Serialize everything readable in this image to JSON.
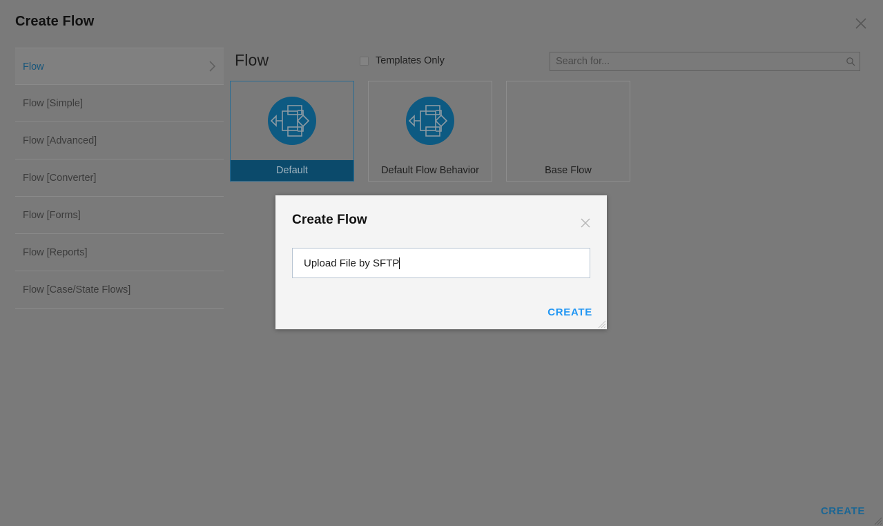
{
  "wizard": {
    "title": "Create Flow",
    "close_icon": "close-icon",
    "create_label": "CREATE",
    "panel_title": "Flow",
    "templates_only_label": "Templates Only",
    "templates_only_checked": false
  },
  "sidebar": {
    "items": [
      {
        "label": "Flow",
        "selected": true,
        "chevron": "chevron-right-icon"
      },
      {
        "label": "Flow [Simple]",
        "selected": false
      },
      {
        "label": "Flow [Advanced]",
        "selected": false
      },
      {
        "label": "Flow [Converter]",
        "selected": false
      },
      {
        "label": "Flow [Forms]",
        "selected": false
      },
      {
        "label": "Flow [Reports]",
        "selected": false
      },
      {
        "label": "Flow [Case/State Flows]",
        "selected": false
      }
    ]
  },
  "search": {
    "value": "",
    "placeholder": "Search for...",
    "icon": "search-icon"
  },
  "cards": [
    {
      "label": "Default",
      "selected": true,
      "has_icon": true,
      "icon": "flow-diagram-icon"
    },
    {
      "label": "Default Flow Behavior",
      "selected": false,
      "has_icon": true,
      "icon": "flow-diagram-icon"
    },
    {
      "label": "Base Flow",
      "selected": false,
      "has_icon": false
    }
  ],
  "modal": {
    "title": "Create Flow",
    "close_icon": "close-icon",
    "name_value": "Upload File by SFTP",
    "name_placeholder": "",
    "create_label": "CREATE"
  },
  "colors": {
    "overlay": "#7a7a7a",
    "accent_blue": "#0b4a6b",
    "icon_blue": "#0d5a82",
    "link_blue": "#2196f3",
    "sidebar_link": "#16557a",
    "modal_bg": "#f4f4f4",
    "footer_create": "#1b6694"
  }
}
